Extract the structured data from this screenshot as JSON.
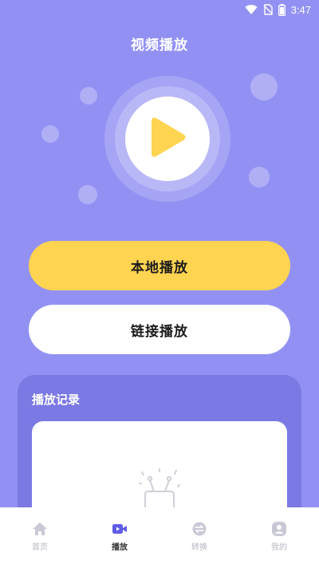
{
  "status_bar": {
    "time": "3:47",
    "icons": [
      "wifi-icon",
      "no-sim-icon",
      "battery-icon"
    ]
  },
  "header": {
    "title": "视频播放"
  },
  "hero": {
    "icon": "play-icon",
    "accent_color": "#ffd451"
  },
  "actions": {
    "local_play_label": "本地播放",
    "link_play_label": "链接播放"
  },
  "history": {
    "title": "播放记录",
    "empty_icon": "empty-tv-icon"
  },
  "tabs": [
    {
      "label": "首页",
      "icon": "home-icon",
      "active": false
    },
    {
      "label": "播放",
      "icon": "video-icon",
      "active": true
    },
    {
      "label": "转换",
      "icon": "convert-icon",
      "active": false
    },
    {
      "label": "我的",
      "icon": "profile-icon",
      "active": false
    }
  ],
  "colors": {
    "background": "#9291f3",
    "card": "#7b79e4",
    "primary_button": "#ffd451",
    "tab_active": "#5f5ce8",
    "tab_inactive": "#c9c9d6"
  }
}
